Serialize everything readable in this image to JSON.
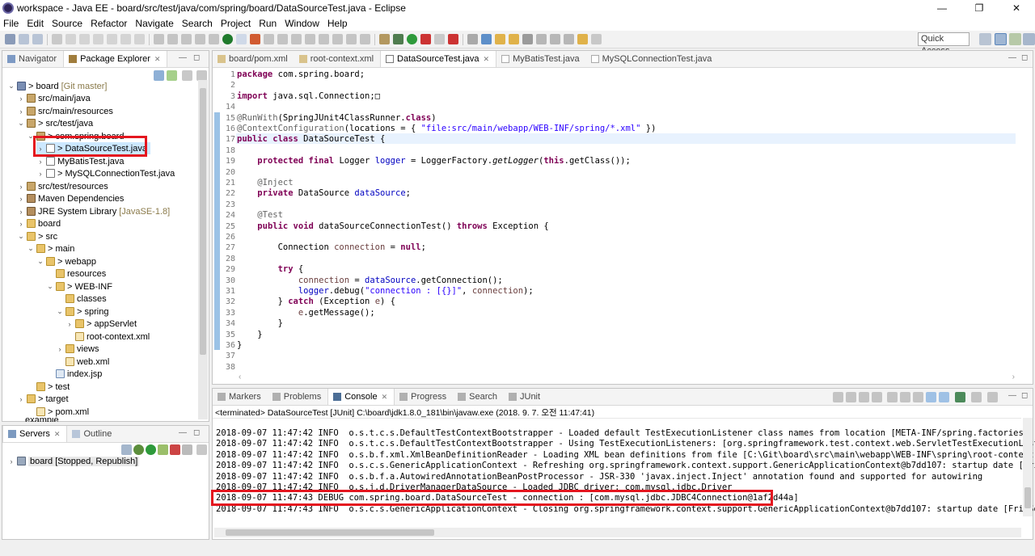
{
  "window": {
    "title": "workspace - Java EE - board/src/test/java/com/spring/board/DataSourceTest.java - Eclipse"
  },
  "menu": [
    "File",
    "Edit",
    "Source",
    "Refactor",
    "Navigate",
    "Search",
    "Project",
    "Run",
    "Window",
    "Help"
  ],
  "quick_access": "Quick Access",
  "explorer": {
    "tabs": [
      "Navigator",
      "Package Explorer"
    ],
    "items": [
      {
        "label": "> board",
        "dim": "[Git master]"
      },
      {
        "label": "src/main/java"
      },
      {
        "label": "src/main/resources"
      },
      {
        "label": "> src/test/java"
      },
      {
        "label": "> com.spring.board"
      },
      {
        "label": "> DataSourceTest.java"
      },
      {
        "label": "MyBatisTest.java"
      },
      {
        "label": "> MySQLConnectionTest.java"
      },
      {
        "label": "src/test/resources"
      },
      {
        "label": "Maven Dependencies"
      },
      {
        "label": "JRE System Library",
        "dim": "[JavaSE-1.8]"
      },
      {
        "label": "board"
      },
      {
        "label": "> src"
      },
      {
        "label": "> main"
      },
      {
        "label": "> webapp"
      },
      {
        "label": "resources"
      },
      {
        "label": "> WEB-INF"
      },
      {
        "label": "classes"
      },
      {
        "label": "> spring"
      },
      {
        "label": "> appServlet"
      },
      {
        "label": "root-context.xml"
      },
      {
        "label": "views"
      },
      {
        "label": "web.xml"
      },
      {
        "label": "index.jsp"
      },
      {
        "label": "> test"
      },
      {
        "label": "> target"
      },
      {
        "label": "> pom.xml"
      },
      {
        "label": "example"
      }
    ]
  },
  "servers": {
    "tabs": [
      "Servers",
      "Outline"
    ],
    "items": [
      {
        "label": "board  [Stopped, Republish]"
      }
    ]
  },
  "editor": {
    "tabs": [
      "board/pom.xml",
      "root-context.xml",
      "DataSourceTest.java",
      "MyBatisTest.java",
      "MySQLConnectionTest.java"
    ],
    "line_numbers": [
      "1",
      "2",
      "3",
      "14",
      "15",
      "16",
      "17",
      "18",
      "19",
      "20",
      "21",
      "22",
      "23",
      "24",
      "25",
      "26",
      "27",
      "28",
      "29",
      "30",
      "31",
      "32",
      "33",
      "34",
      "35",
      "36",
      "37",
      "38"
    ]
  },
  "console": {
    "tabs": [
      "Markers",
      "Problems",
      "Console",
      "Progress",
      "Search",
      "JUnit"
    ],
    "header": "<terminated> DataSourceTest [JUnit] C:\\board\\jdk1.8.0_181\\bin\\javaw.exe (2018. 9. 7. 오전 11:47:41)",
    "lines": [
      "2018-09-07 11:47:42 INFO  o.s.t.c.s.DefaultTestContextBootstrapper - Loaded default TestExecutionListener class names from location [META-INF/spring.factories]: [org.",
      "2018-09-07 11:47:42 INFO  o.s.t.c.s.DefaultTestContextBootstrapper - Using TestExecutionListeners: [org.springframework.test.context.web.ServletTestExecutionListener@",
      "2018-09-07 11:47:42 INFO  o.s.b.f.xml.XmlBeanDefinitionReader - Loading XML bean definitions from file [C:\\Git\\board\\src\\main\\webapp\\WEB-INF\\spring\\root-context.xml]",
      "2018-09-07 11:47:42 INFO  o.s.c.s.GenericApplicationContext - Refreshing org.springframework.context.support.GenericApplicationContext@b7dd107: startup date [Fri Sep 07",
      "2018-09-07 11:47:42 INFO  o.s.b.f.a.AutowiredAnnotationBeanPostProcessor - JSR-330 'javax.inject.Inject' annotation found and supported for autowiring",
      "2018-09-07 11:47:42 INFO  o.s.j.d.DriverManagerDataSource - Loaded JDBC driver: com.mysql.jdbc.Driver",
      "2018-09-07 11:47:43 DEBUG com.spring.board.DataSourceTest - connection : [com.mysql.jdbc.JDBC4Connection@1af2d44a]",
      "2018-09-07 11:47:43 INFO  o.s.c.s.GenericApplicationContext - Closing org.springframework.context.support.GenericApplicationContext@b7dd107: startup date [Fri Sep 07 1"
    ]
  },
  "colors": {
    "highlight": "#e4161f",
    "selection": "#cce8ff",
    "current_line": "#e8f2fe"
  }
}
